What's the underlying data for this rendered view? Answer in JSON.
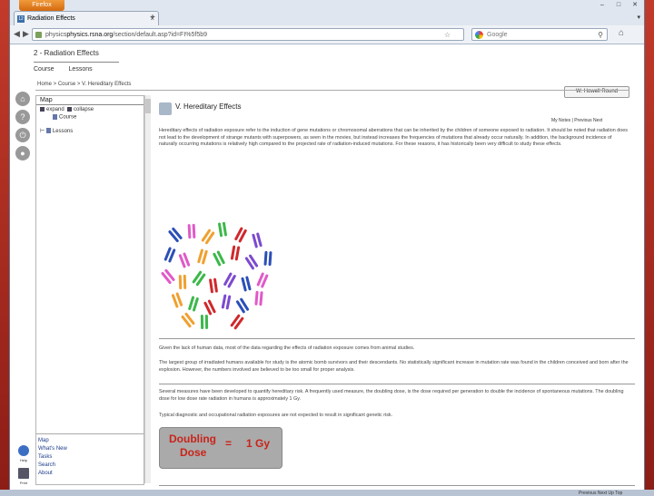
{
  "browser": {
    "app_button": "Firefox",
    "tab_title": "Radiation Effects",
    "url_domain": "physics.rsna.org",
    "url_path": "/section/default.asp?id=FI%5f5b9",
    "url_pre": "physics",
    "search_engine": "Google",
    "search_placeholder": "Google"
  },
  "site": {
    "title": "2 - Radiation Effects",
    "nav": [
      "Course",
      "Lessons"
    ],
    "breadcrumb": "Home > Course > V. Hereditary Effects",
    "user": "W. Howell Round"
  },
  "map": {
    "header": "Map",
    "expand": "expand",
    "collapse": "collapse",
    "course": "Course",
    "lessons": "Lessons",
    "footer": [
      "Map",
      "What's New",
      "Tasks",
      "Search",
      "About"
    ]
  },
  "footer_icon_labels": [
    "Help",
    "Print"
  ],
  "content": {
    "heading": "V. Hereditary Effects",
    "links": "My Notes  |  Previous  Next",
    "p1": "Hereditary effects of radiation exposure refer to the induction of gene mutations or chromosomal aberrations that can be inherited by the children of someone exposed to radiation. It should be noted that radiation does not lead to the development of strange mutants with superpowers, as seen in the movies, but instead increases the frequencies of mutations that already occur naturally. In addition, the background incidence of naturally occurring mutations is relatively high compared to the projected rate of radiation-induced mutations. For these reasons, it has historically been very difficult to study these effects.",
    "p2": "Given the lack of human data, most of the data regarding the effects of radiation exposure comes from animal studies.",
    "p3": "The largest group of irradiated humans available for study is the atomic bomb survivors and their descendants. No statistically significant increase in mutation rate was found in the children conceived and born after the explosion. However, the numbers involved are believed to be too small for proper analysis.",
    "p4": "Several measures have been developed to quantify hereditary risk. A frequently used measure, the doubling dose, is the dose required per generation to double the incidence of spontaneous mutations. The doubling dose for low dose rate radiation in humans is approximately 1 Gy.",
    "p5": "Typical diagnostic and occupational radiation exposures are not expected to result in significant genetic risk.",
    "dose_word1": "Doubling",
    "dose_word2": "Dose",
    "dose_eq": "=",
    "dose_val": "1 Gy",
    "bottom_links": "Previous  Next  Up  Top"
  },
  "colors": {
    "dose_text": "#c8241a",
    "link": "#1a3a8a",
    "chromosomes": [
      "#2b4fb8",
      "#e05ac8",
      "#f0a030",
      "#3cb84a",
      "#d0282c",
      "#7c4ad0"
    ]
  }
}
